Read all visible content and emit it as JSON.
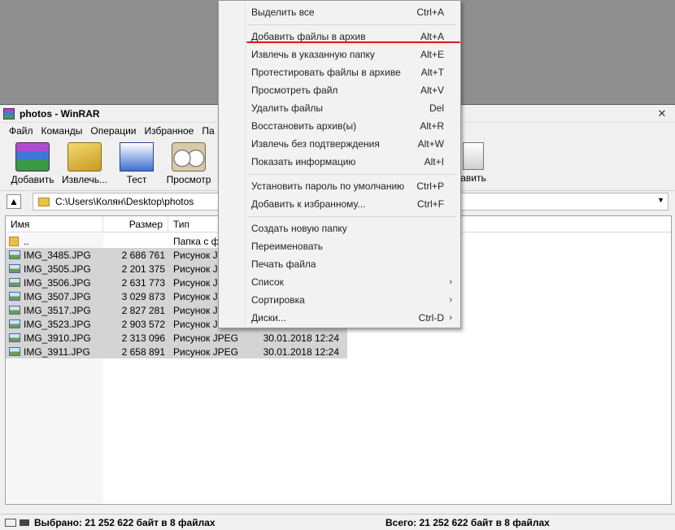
{
  "window": {
    "title": "photos - WinRAR",
    "close_glyph": "✕"
  },
  "menubar": [
    "Файл",
    "Команды",
    "Операции",
    "Избранное",
    "Па"
  ],
  "toolbar": [
    {
      "label": "Добавить",
      "icon": "archive-add-icon"
    },
    {
      "label": "Извлечь...",
      "icon": "extract-icon"
    },
    {
      "label": "Тест",
      "icon": "test-icon"
    },
    {
      "label": "Просмотр",
      "icon": "view-icon"
    },
    {
      "label": "авить",
      "icon": "repair-icon"
    }
  ],
  "address": {
    "path": "C:\\Users\\Колян\\Desktop\\photos"
  },
  "columns": {
    "name": "Имя",
    "size": "Размер",
    "type": "Тип"
  },
  "files": [
    {
      "name": "..",
      "size": "",
      "type": "Папка с фа",
      "date": "",
      "folder": true,
      "selected": false
    },
    {
      "name": "IMG_3485.JPG",
      "size": "2 686 761",
      "type": "Рисунок JPE",
      "date": "",
      "selected": true
    },
    {
      "name": "IMG_3505.JPG",
      "size": "2 201 375",
      "type": "Рисунок JPE",
      "date": "",
      "selected": true
    },
    {
      "name": "IMG_3506.JPG",
      "size": "2 631 773",
      "type": "Рисунок JPE",
      "date": "",
      "selected": true
    },
    {
      "name": "IMG_3507.JPG",
      "size": "3 029 873",
      "type": "Рисунок JPE",
      "date": "",
      "selected": true
    },
    {
      "name": "IMG_3517.JPG",
      "size": "2 827 281",
      "type": "Рисунок JPE",
      "date": "",
      "selected": true
    },
    {
      "name": "IMG_3523.JPG",
      "size": "2 903 572",
      "type": "Рисунок JPE",
      "date": "",
      "selected": true
    },
    {
      "name": "IMG_3910.JPG",
      "size": "2 313 096",
      "type": "Рисунок JPEG",
      "date": "30.01.2018 12:24",
      "selected": true
    },
    {
      "name": "IMG_3911.JPG",
      "size": "2 658 891",
      "type": "Рисунок JPEG",
      "date": "30.01.2018 12:24",
      "selected": true
    }
  ],
  "status": {
    "selected": "Выбрано: 21 252 622 байт в 8 файлах",
    "total": "Всего: 21 252 622 байт в 8 файлах"
  },
  "context_menu": {
    "groups": [
      [
        {
          "label": "Выделить все",
          "key": "Ctrl+A"
        }
      ],
      [
        {
          "label": "Добавить файлы в архив",
          "key": "Alt+A",
          "highlighted": true
        },
        {
          "label": "Извлечь в указанную папку",
          "key": "Alt+E"
        },
        {
          "label": "Протестировать файлы в архиве",
          "key": "Alt+T"
        },
        {
          "label": "Просмотреть файл",
          "key": "Alt+V"
        },
        {
          "label": "Удалить файлы",
          "key": "Del"
        },
        {
          "label": "Восстановить архив(ы)",
          "key": "Alt+R"
        },
        {
          "label": "Извлечь без подтверждения",
          "key": "Alt+W"
        },
        {
          "label": "Показать информацию",
          "key": "Alt+I"
        }
      ],
      [
        {
          "label": "Установить пароль по умолчанию",
          "key": "Ctrl+P"
        },
        {
          "label": "Добавить к избранному...",
          "key": "Ctrl+F"
        }
      ],
      [
        {
          "label": "Создать новую папку",
          "key": ""
        },
        {
          "label": "Переименовать",
          "key": ""
        },
        {
          "label": "Печать файла",
          "key": ""
        },
        {
          "label": "Список",
          "key": "",
          "submenu": true
        },
        {
          "label": "Сортировка",
          "key": "",
          "submenu": true
        },
        {
          "label": "Диски...",
          "key": "Ctrl-D",
          "submenu": true
        }
      ]
    ]
  },
  "colors": {
    "highlight_underline": "#e01818",
    "selection": "#d4d4d4"
  }
}
